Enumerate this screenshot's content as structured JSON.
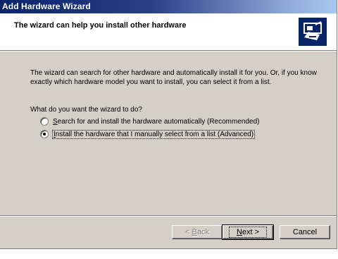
{
  "window": {
    "title": "Add Hardware Wizard"
  },
  "header": {
    "title": "The wizard can help you install other hardware",
    "icon": "hardware-card-icon"
  },
  "body": {
    "description": "The wizard can search for other hardware and automatically install it for you. Or, if you know exactly which hardware model you want to install, you can select it from a list.",
    "question": "What do you want the wizard to do?",
    "options": [
      {
        "mnemonic": "S",
        "rest": "earch for and install the hardware automatically (Recommended)",
        "selected": false
      },
      {
        "mnemonic": "I",
        "rest": "nstall the hardware that I manually select from a list (Advanced)",
        "selected": true
      }
    ]
  },
  "buttons": {
    "back_prefix": "< ",
    "back_mnemonic": "B",
    "back_rest": "ack",
    "next_mnemonic": "N",
    "next_rest": "ext >",
    "cancel": "Cancel"
  },
  "colors": {
    "title_bar_start": "#0a246a",
    "title_bar_end": "#a6caf0",
    "dialog_background": "#d4d0c8",
    "header_background": "#ffffff"
  }
}
